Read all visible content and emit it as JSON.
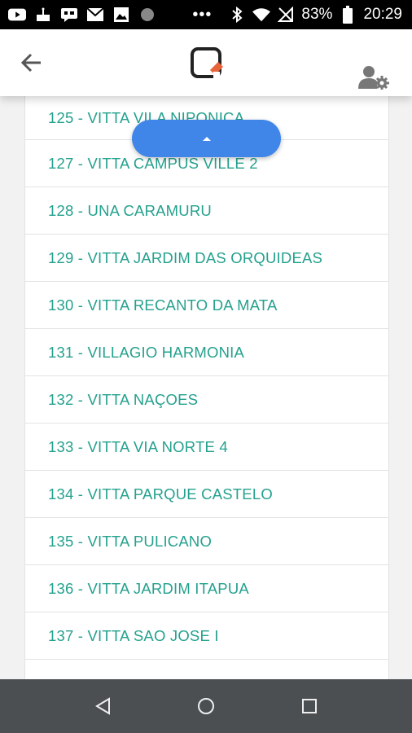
{
  "status_bar": {
    "battery": "83%",
    "time": "20:29",
    "left_icons": [
      "youtube-icon",
      "cake-icon",
      "chat-icon",
      "gmail-icon",
      "gallery-icon",
      "circle-icon"
    ],
    "right_icons": [
      "bluetooth-icon",
      "wifi-icon",
      "no-signal-icon",
      "battery-icon"
    ]
  },
  "header": {
    "back_icon": "arrow-back-icon",
    "logo": "app-logo",
    "user_settings_icon": "user-cog-icon"
  },
  "list": {
    "items": [
      {
        "label": "125 - VITTA VILA NIPONICA"
      },
      {
        "label": "127 - VITTA CAMPUS VILLE 2"
      },
      {
        "label": "128 - UNA CARAMURU"
      },
      {
        "label": "129 - VITTA JARDIM DAS ORQUIDEAS"
      },
      {
        "label": "130 - VITTA RECANTO DA MATA"
      },
      {
        "label": "131 - VILLAGIO HARMONIA"
      },
      {
        "label": "132 - VITTA NAÇOES"
      },
      {
        "label": "133 - VITTA VIA NORTE 4"
      },
      {
        "label": "134 - VITTA PARQUE CASTELO"
      },
      {
        "label": "135 - VITTA PULICANO"
      },
      {
        "label": "136 - VITTA JARDIM ITAPUA"
      },
      {
        "label": "137 - VITTA SAO JOSE I"
      },
      {
        "label": ""
      }
    ],
    "text_color": "#25a18e"
  },
  "scroll_top_button": {
    "icon": "caret-up-icon",
    "color": "#3f86e8"
  },
  "nav_bar": {
    "buttons": [
      "back-triangle-icon",
      "home-circle-icon",
      "recents-square-icon"
    ]
  }
}
